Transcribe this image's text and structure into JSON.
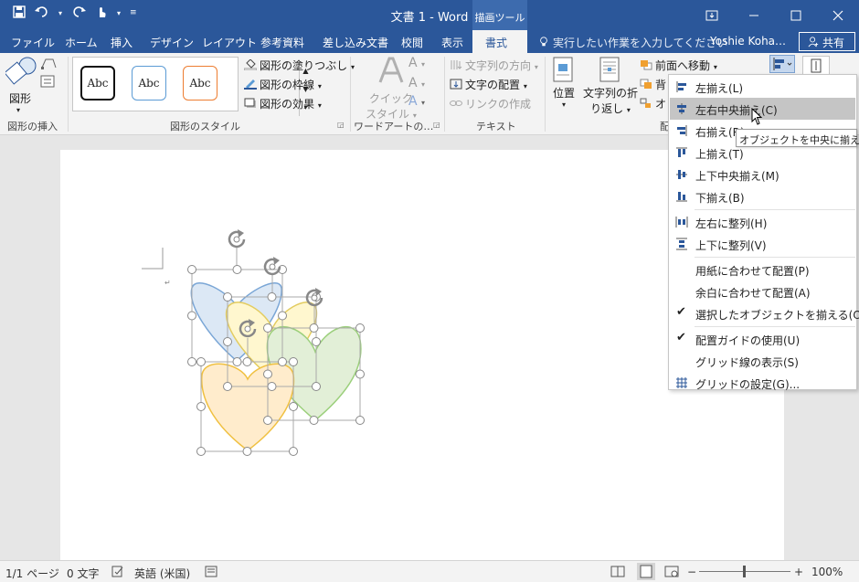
{
  "titlebar": {
    "doc_title": "文書 1 - Word",
    "context_tab_label": "描画ツール"
  },
  "tabs": [
    {
      "label": "ファイル"
    },
    {
      "label": "ホーム"
    },
    {
      "label": "挿入"
    },
    {
      "label": "デザイン"
    },
    {
      "label": "レイアウト"
    },
    {
      "label": "参考資料"
    },
    {
      "label": "差し込み文書"
    },
    {
      "label": "校閲"
    },
    {
      "label": "表示"
    },
    {
      "label": "書式"
    }
  ],
  "tellme": "実行したい作業を入力してください",
  "user": "Yoshie Koha…",
  "share": "共有",
  "ribbon": {
    "shape_label": "図形",
    "group_insert_shapes": "図形の挿入",
    "style_sample": "Abc",
    "shape_fill": "図形の塗りつぶし",
    "shape_outline": "図形の枠線",
    "shape_effects": "図形の効果",
    "group_shape_styles": "図形のスタイル",
    "quick_styles_1": "クイック",
    "quick_styles_2": "スタイル",
    "group_wordart": "ワードアートの…",
    "text_direction": "文字列の方向",
    "align_text": "文字の配置",
    "create_link": "リンクの作成",
    "group_text": "テキスト",
    "position": "位置",
    "wrap_text_1": "文字列の折",
    "wrap_text_2": "り返し",
    "bring_forward": "前面へ移動",
    "send_backward": "背",
    "selection_pane": "オ",
    "group_arrange": "配"
  },
  "align_menu": {
    "items": [
      {
        "label": "左揃え(L)"
      },
      {
        "label": "左右中央揃え(C)"
      },
      {
        "label": "右揃え(R)"
      },
      {
        "label": "上揃え(T)"
      },
      {
        "label": "上下中央揃え(M)"
      },
      {
        "label": "下揃え(B)"
      },
      {
        "label": "左右に整列(H)"
      },
      {
        "label": "上下に整列(V)"
      },
      {
        "label": "用紙に合わせて配置(P)"
      },
      {
        "label": "余白に合わせて配置(A)"
      },
      {
        "label": "選択したオブジェクトを揃える(O)"
      },
      {
        "label": "配置ガイドの使用(U)"
      },
      {
        "label": "グリッド線の表示(S)"
      },
      {
        "label": "グリッドの設定(G)..."
      }
    ],
    "highlighted": "左右中央揃え(C)",
    "tooltip": "オブジェクトを中央に揃える"
  },
  "status": {
    "page": "1/1 ページ",
    "words": "0 文字",
    "language": "英語 (米国)",
    "zoom": "100%"
  },
  "colors": {
    "brand": "#2b579a",
    "heart_blue": "#dce8f5",
    "heart_yellow": "#fff7cf",
    "heart_green": "#e2efd7",
    "heart_orange": "#ffeccc"
  }
}
